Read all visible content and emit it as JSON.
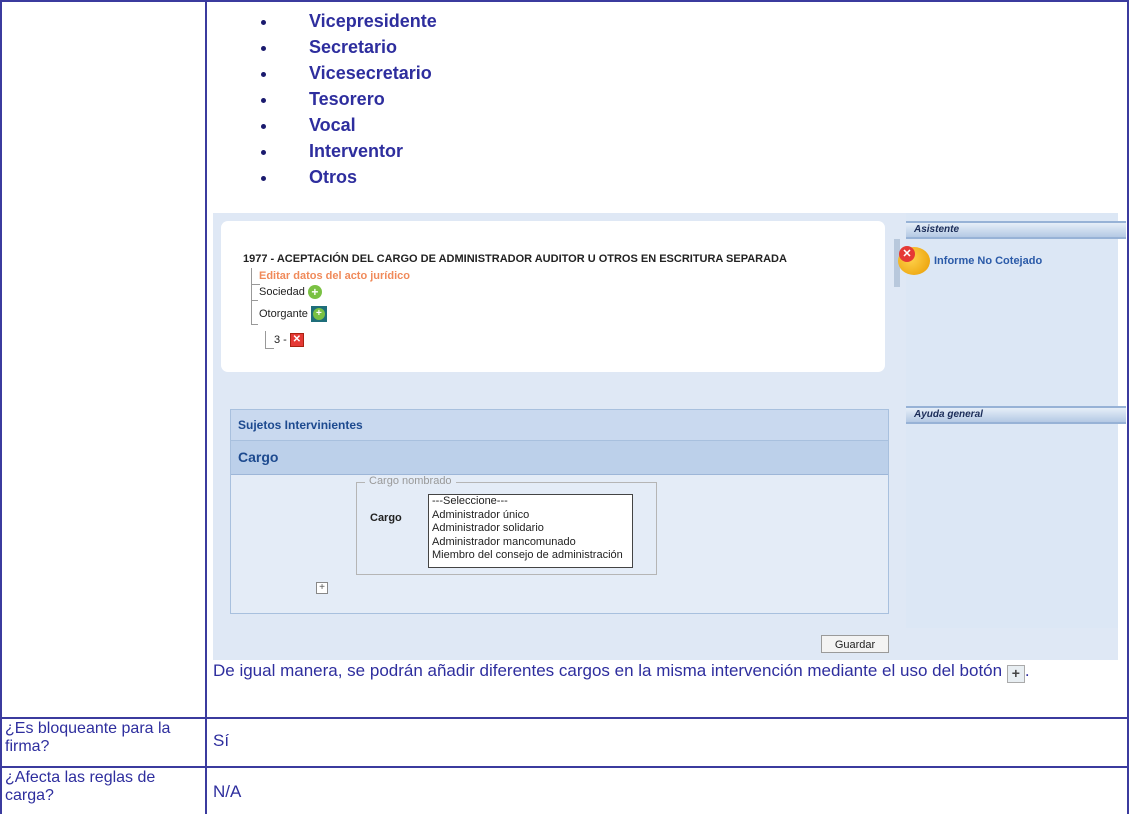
{
  "bullets": [
    "Vicepresidente",
    "Secretario",
    "Vicesecretario",
    "Tesorero",
    "Vocal",
    "Interventor",
    "Otros"
  ],
  "app": {
    "act_title": "1977 - ACEPTACIÓN DEL CARGO DE ADMINISTRADOR AUDITOR U OTROS EN ESCRITURA SEPARADA",
    "tree": {
      "edit_link": "Editar datos del acto jurídico",
      "sociedad": "Sociedad",
      "otorgante": "Otorgante",
      "child": "3 -"
    },
    "panel": {
      "header": "Sujetos Intervinientes",
      "subheader": "Cargo",
      "legend": "Cargo nombrado",
      "field_label": "Cargo",
      "options": [
        "---Seleccione---",
        "Administrador único",
        "Administrador solidario",
        "Administrador mancomunado",
        "Miembro del consejo de administración"
      ]
    },
    "save_label": "Guardar",
    "sidebar": {
      "assistant_title": "Asistente",
      "assistant_link": "Informe No Cotejado",
      "help_title": "Ayuda general"
    }
  },
  "paragraph": {
    "text": "De igual manera, se podrán añadir diferentes cargos en la misma intervención mediante el uso del botón",
    "end": "."
  },
  "rows": [
    {
      "label": "¿Es bloqueante para la firma?",
      "value": "Sí"
    },
    {
      "label": "¿Afecta las reglas de carga?",
      "value": "N/A"
    }
  ]
}
